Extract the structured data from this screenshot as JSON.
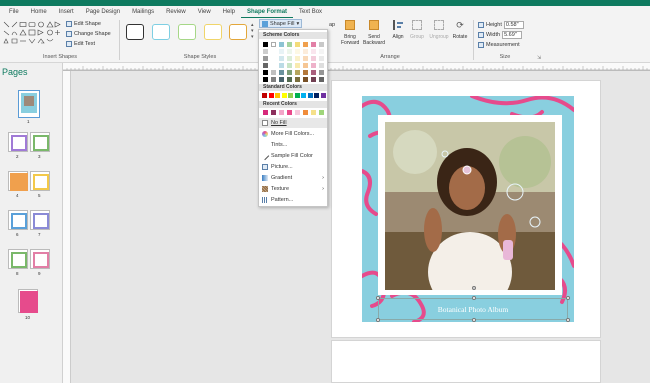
{
  "ribbon_tabs": [
    "File",
    "Home",
    "Insert",
    "Page Design",
    "Mailings",
    "Review",
    "View",
    "Help",
    "Shape Format",
    "Text Box"
  ],
  "active_tab_index": 8,
  "insert_shapes": {
    "edit_shape": "Edit Shape",
    "change_shape": "Change Shape",
    "edit_text": "Edit Text",
    "label": "Insert Shapes"
  },
  "shape_styles": {
    "label": "Shape Styles",
    "swatch_borders": [
      "#333333",
      "#7ecfe3",
      "#a6d787",
      "#f0d56a",
      "#e3a73a"
    ]
  },
  "shape_fill_button": "Shape Fill",
  "arrange": {
    "label": "Arrange",
    "bring_forward": "Bring Forward",
    "send_backward": "Send Backward",
    "align": "Align",
    "group": "Group",
    "ungroup": "Ungroup",
    "rotate": "Rotate",
    "wrap_text_fragment": "ap"
  },
  "size": {
    "label": "Size",
    "height_label": "Height",
    "height_value": "0.58\"",
    "width_label": "Width",
    "width_value": "5.69\"",
    "measurement": "Measurement"
  },
  "pages_pane": {
    "title": "Pages",
    "page_numbers": [
      "1",
      "2",
      "3",
      "4",
      "5",
      "6",
      "7",
      "8",
      "9",
      "10"
    ]
  },
  "fill_menu": {
    "theme_colors_label": "Scheme Colors",
    "standard_colors_label": "Standard Colors",
    "recent_colors_label": "Recent Colors",
    "scheme_colors": [
      "#000000",
      "#ffffff",
      "#8dc3d3",
      "#a5d3a0",
      "#f3dc7a",
      "#f0a04d",
      "#e27fa6",
      "#c8c8c8"
    ],
    "standard_colors": [
      "#c00000",
      "#ff0000",
      "#ffc000",
      "#ffff00",
      "#92d050",
      "#00b050",
      "#00b0f0",
      "#0070c0",
      "#002060",
      "#7030a0"
    ],
    "recent_colors": [
      "#d6287a",
      "#8c2f5c",
      "#f3a6c8",
      "#e94a8b",
      "#f6c8dc",
      "#f08c3a",
      "#f5e08a",
      "#9fd57a"
    ],
    "items": [
      "No Fill",
      "More Fill Colors...",
      "Tints...",
      "Sample Fill Color",
      "Picture...",
      "Gradient",
      "Texture",
      "Pattern..."
    ]
  },
  "caption_text": "Botanical Photo Album",
  "colors": {
    "accent": "#0e7a5f",
    "album_background": "#89cfdf",
    "ribbon_pink": "#e64b8c"
  }
}
